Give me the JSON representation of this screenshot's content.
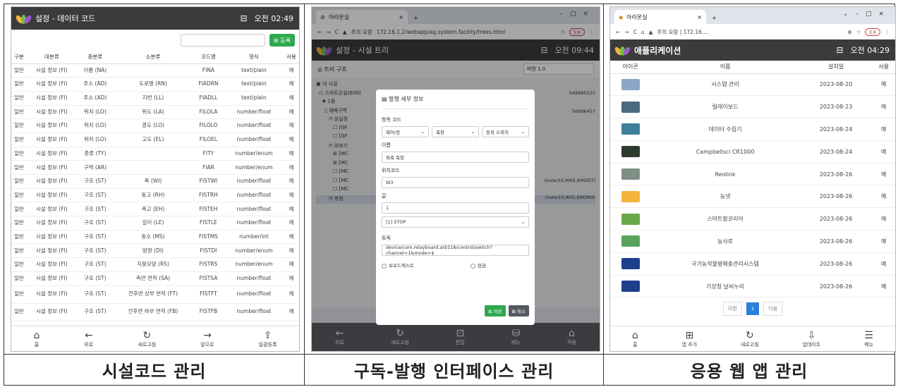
{
  "captions": [
    "시설코드 관리",
    "구독-발행 인터페이스 관리",
    "응용 웹 앱 관리"
  ],
  "panel1": {
    "title": "설정 - 데이터 코드",
    "time": "오전 02:49",
    "register_label": "등록",
    "headers": [
      "구분",
      "대분류",
      "중분류",
      "소분류",
      "코드명",
      "형식",
      "사용"
    ],
    "rows": [
      [
        "일반",
        "시설 정보 (FI)",
        "이름 (NA)",
        "",
        "FINA",
        "text/plain",
        "예"
      ],
      [
        "일반",
        "시설 정보 (FI)",
        "주소 (AD)",
        "도로명 (RN)",
        "FIADRN",
        "text/plain",
        "예"
      ],
      [
        "일반",
        "시설 정보 (FI)",
        "주소 (AD)",
        "지번 (LL)",
        "FIADLL",
        "text/plain",
        "예"
      ],
      [
        "일반",
        "시설 정보 (FI)",
        "위치 (LO)",
        "위도 (LA)",
        "FILOLA",
        "number/float",
        "예"
      ],
      [
        "일반",
        "시설 정보 (FI)",
        "위치 (LO)",
        "경도 (LO)",
        "FILOLO",
        "number/float",
        "예"
      ],
      [
        "일반",
        "시설 정보 (FI)",
        "위치 (LO)",
        "고도 (EL)",
        "FILOEL",
        "number/float",
        "예"
      ],
      [
        "일반",
        "시설 정보 (FI)",
        "종류 (TY)",
        "",
        "FITY",
        "number/enum",
        "예"
      ],
      [
        "일반",
        "시설 정보 (FI)",
        "구역 (AR)",
        "",
        "FIAR",
        "number/enum",
        "예"
      ],
      [
        "일반",
        "시설 정보 (FI)",
        "구조 (ST)",
        "폭 (WI)",
        "FISTWI",
        "number/float",
        "예"
      ],
      [
        "일반",
        "시설 정보 (FI)",
        "구조 (ST)",
        "동고 (RH)",
        "FISTRH",
        "number/float",
        "예"
      ],
      [
        "일반",
        "시설 정보 (FI)",
        "구조 (ST)",
        "측고 (EH)",
        "FISTEH",
        "number/float",
        "예"
      ],
      [
        "일반",
        "시설 정보 (FI)",
        "구조 (ST)",
        "길이 (LE)",
        "FISTLE",
        "number/float",
        "예"
      ],
      [
        "일반",
        "시설 정보 (FI)",
        "구조 (ST)",
        "동수 (MS)",
        "FISTMS",
        "number/int",
        "예"
      ],
      [
        "일반",
        "시설 정보 (FI)",
        "구조 (ST)",
        "방향 (DI)",
        "FISTDI",
        "number/enum",
        "예"
      ],
      [
        "일반",
        "시설 정보 (FI)",
        "구조 (ST)",
        "지붕모양 (RS)",
        "FISTRS",
        "number/enum",
        "예"
      ],
      [
        "일반",
        "시설 정보 (FI)",
        "구조 (ST)",
        "측면 면적 (SA)",
        "FISTSA",
        "number/float",
        "예"
      ],
      [
        "일반",
        "시설 정보 (FI)",
        "구조 (ST)",
        "전후면 상부 면적 (FT)",
        "FISTFT",
        "number/float",
        "예"
      ],
      [
        "일반",
        "시설 정보 (FI)",
        "구조 (ST)",
        "전후면 하부 면적 (FB)",
        "FISTFB",
        "number/float",
        "예"
      ]
    ],
    "nav": [
      "홈",
      "뒤로",
      "새로고침",
      "앞으로",
      "일괄등록"
    ]
  },
  "panel2": {
    "tab_title": "아라온실",
    "url": "172.16.1.2/webapp/ag.system.facility/trees.html",
    "security": "주의 요함",
    "profile_badge": "오류",
    "title": "설정 - 시설 트리",
    "time": "오전 09:44",
    "tree_header": "트리 구조",
    "version": "버전 1.0",
    "tree": [
      "내 시설",
      "스마트온실(B38)",
      "1동",
      "재배구역",
      "온실정",
      "[GF",
      "[GF",
      "외부기",
      "[MC",
      "[MC",
      "[MC",
      "[MC",
      "[MC",
      "측정"
    ],
    "side_values": [
      "548880125",
      "56896457",
      "inute/10,MAX,$MODT)",
      "inute/10,AVG,$MORH)"
    ],
    "modal": {
      "title": "발행 세부 정보",
      "item_code_label": "항목 코드",
      "item_code": [
        "제어/장",
        "측창",
        "동작 스위치"
      ],
      "name_label": "이름",
      "name_value": "좌측 측창",
      "position_label": "위치코드",
      "position_value": "W3",
      "value_label": "값",
      "value_value": "1",
      "value_select": "[1] STOP",
      "topic_label": "토픽",
      "topic_value": "device/com.relayboard.arb116/control/switch?channel=1&mode=$",
      "broadcast_label": "브로드캐스트",
      "lock_label": "잠금",
      "save_label": "저장",
      "cancel_label": "취소"
    },
    "nav": [
      "뒤로",
      "새로고침",
      "편집",
      "메뉴",
      "적용"
    ]
  },
  "panel3": {
    "tab_title": "아라온실",
    "url": "주의 요함 | 172.16....",
    "profile_badge": "오류",
    "title": "애플리케이션",
    "time": "오전 04:29",
    "headers": [
      "아이콘",
      "이름",
      "설치일",
      "사용"
    ],
    "rows": [
      {
        "name": "시스템 관리",
        "date": "2023-08-20",
        "use": "예",
        "icon_color": "#8aa6c8"
      },
      {
        "name": "릴레이보드",
        "date": "2023-08-23",
        "use": "예",
        "icon_color": "#4a6a7e"
      },
      {
        "name": "데이터 수집기",
        "date": "2023-08-24",
        "use": "예",
        "icon_color": "#3f7f9a"
      },
      {
        "name": "Campbellsci CR1000",
        "date": "2023-08-24",
        "use": "예",
        "icon_color": "#2d3b2f"
      },
      {
        "name": "Reolink",
        "date": "2023-08-26",
        "use": "예",
        "icon_color": "#7f8f86"
      },
      {
        "name": "농넷",
        "date": "2023-08-26",
        "use": "예",
        "icon_color": "#f2b43a"
      },
      {
        "name": "스마트팜코리아",
        "date": "2023-08-26",
        "use": "예",
        "icon_color": "#69a84a"
      },
      {
        "name": "농사로",
        "date": "2023-08-26",
        "use": "예",
        "icon_color": "#5aa35c"
      },
      {
        "name": "국가농작물병해충관리시스템",
        "date": "2023-08-26",
        "use": "예",
        "icon_color": "#1e3f8c"
      },
      {
        "name": "기상청 날씨누리",
        "date": "2023-08-26",
        "use": "예",
        "icon_color": "#1e3f8c"
      }
    ],
    "pager": {
      "prev": "이전",
      "current": "1",
      "next": "다음"
    },
    "nav": [
      "홈",
      "앱 추가",
      "새로고침",
      "업데이트",
      "메뉴"
    ]
  },
  "colors": {
    "appbar": "#3b3b3b",
    "green": "#2fa84f",
    "blue": "#2a7fdb",
    "cancel": "#555a60"
  }
}
